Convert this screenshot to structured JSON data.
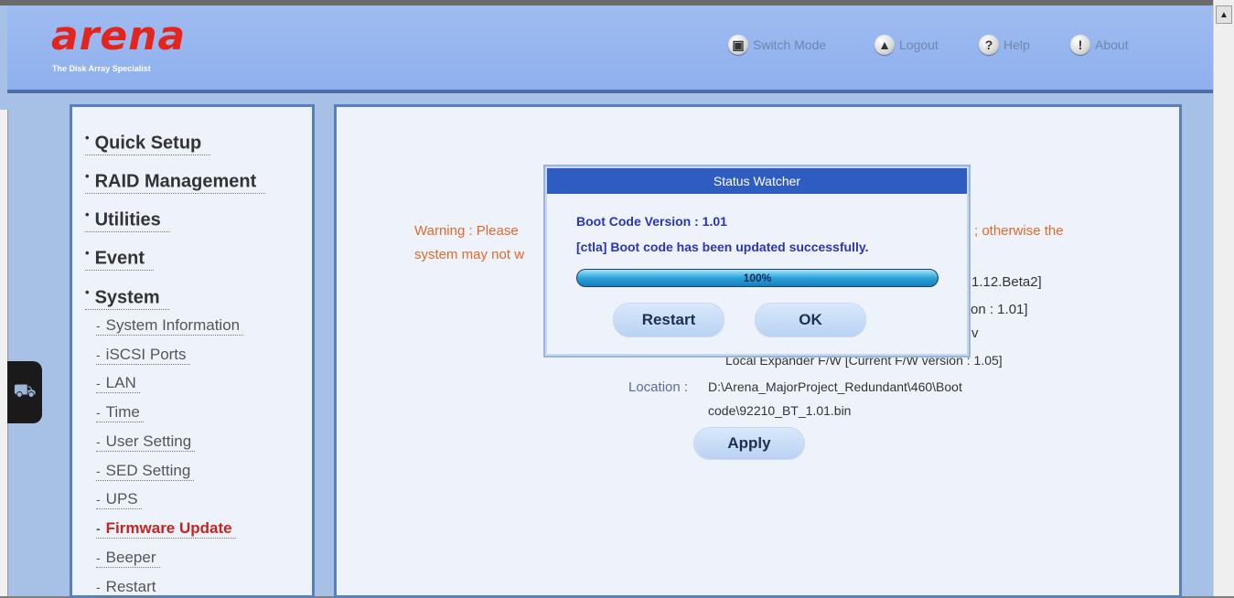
{
  "header": {
    "logo": "arena",
    "tagline": "The Disk Array Specialist",
    "links": [
      {
        "label": "Switch Mode",
        "icon": "switch-mode-icon",
        "glyph": "▣"
      },
      {
        "label": "Logout",
        "icon": "logout-icon",
        "glyph": "▲"
      },
      {
        "label": "Help",
        "icon": "help-icon",
        "glyph": "?"
      },
      {
        "label": "About",
        "icon": "about-icon",
        "glyph": "!"
      }
    ]
  },
  "sidebar": {
    "main_items": [
      {
        "label": "Quick Setup"
      },
      {
        "label": "RAID Management"
      },
      {
        "label": "Utilities"
      },
      {
        "label": "Event"
      },
      {
        "label": "System"
      }
    ],
    "bullet": "•",
    "dash": "-",
    "sub_items": [
      {
        "label": "System Information",
        "active": false
      },
      {
        "label": "iSCSI Ports",
        "active": false
      },
      {
        "label": "LAN",
        "active": false
      },
      {
        "label": "Time",
        "active": false
      },
      {
        "label": "User Setting",
        "active": false
      },
      {
        "label": "SED Setting",
        "active": false
      },
      {
        "label": "UPS",
        "active": false
      },
      {
        "label": "Firmware Update",
        "active": true
      },
      {
        "label": "Beeper",
        "active": false
      },
      {
        "label": "Restart",
        "active": false
      }
    ]
  },
  "main": {
    "warning_line1_left": "Warning : Please",
    "warning_line1_right": "; otherwise the",
    "warning_line2": "system may not w",
    "version_beta": "1.12.Beta2]",
    "version_boot": "on : 1.01]",
    "partial_v": "v",
    "expander_text": "Local Expander F/W [Current F/W version : 1.05]",
    "location_label": "Location :",
    "location_path_line1": "D:\\Arena_MajorProject_Redundant\\460\\Boot",
    "location_path_line2": "code\\92210_BT_1.01.bin",
    "apply_button": "Apply"
  },
  "dialog": {
    "title": "Status Watcher",
    "boot_code_version": "Boot Code Version : 1.01",
    "message": "[ctla] Boot code has been updated successfully.",
    "progress_label": "100%",
    "progress_value": 100,
    "restart_button": "Restart",
    "ok_button": "OK"
  },
  "left_tab": {
    "icon": "network-tool-icon",
    "glyph": "⛟"
  },
  "scrollbar": {
    "up_glyph": "▲"
  },
  "colors": {
    "logo_red": "#e3251d",
    "warning_orange": "#e06a2a",
    "dialog_title_blue": "#2f5cc0",
    "active_item_red": "#c8241f",
    "frame_blue": "#5a7fbf"
  }
}
